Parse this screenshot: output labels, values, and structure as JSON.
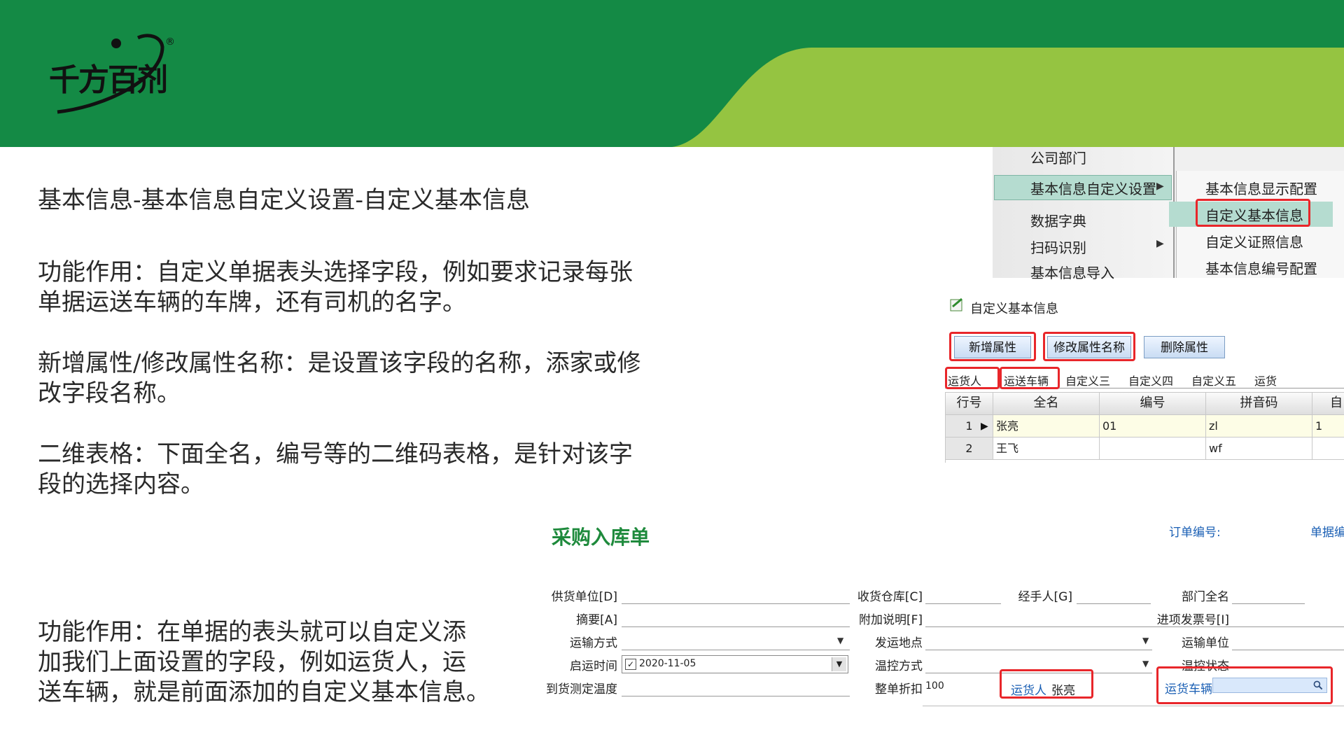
{
  "brand": {
    "logo_text": "千方百剂",
    "registered_mark": "®"
  },
  "colors": {
    "header_dark_green": "#148a45",
    "header_light_green": "#95c441",
    "title_green": "#1e8a3c",
    "highlight_red": "#e8262a",
    "menu_highlight": "#b5dcd0",
    "link_blue": "#1a5fb4"
  },
  "content": {
    "heading": "基本信息-基本信息自定义设置-自定义基本信息",
    "para1_line1": "功能作用：自定义单据表头选择字段，例如要求记录每张",
    "para1_line2": "单据运送车辆的车牌，还有司机的名字。",
    "para2_line1": "新增属性/修改属性名称：是设置该字段的名称，添家或修",
    "para2_line2": "改字段名称。",
    "para3_line1": "二维表格：下面全名，编号等的二维码表格，是针对该字",
    "para3_line2": "段的选择内容。",
    "para4_line1": "功能作用：在单据的表头就可以自定义添",
    "para4_line2": "加我们上面设置的字段，例如运货人，运",
    "para4_line3": "送车辆，就是前面添加的自定义基本信息。"
  },
  "menu": {
    "left_items": [
      "公司部门",
      "基本信息自定义设置",
      "数据字典",
      "扫码识别",
      "基本信息导入"
    ],
    "right_items": [
      "基本信息显示配置",
      "自定义基本信息",
      "自定义证照信息",
      "基本信息编号配置"
    ]
  },
  "custom_info": {
    "window_title": "自定义基本信息",
    "buttons": [
      "新增属性",
      "修改属性名称",
      "删除属性"
    ],
    "tabs": [
      "运货人",
      "运送车辆",
      "自定义三",
      "自定义四",
      "自定义五",
      "运货"
    ],
    "table": {
      "headers": [
        "行号",
        "全名",
        "编号",
        "拼音码",
        "自"
      ],
      "rows": [
        [
          "1",
          "张亮",
          "01",
          "zl",
          "1"
        ],
        [
          "2",
          "王飞",
          "",
          "wf",
          ""
        ]
      ]
    }
  },
  "form": {
    "title": "采购入库单",
    "order_no_label": "订单编号:",
    "doc_no_label": "单据编",
    "labels": {
      "supplier": "供货单位[D]",
      "summary": "摘要[A]",
      "transport_mode": "运输方式",
      "departure_time": "启运时间",
      "arrival_temp": "到货测定温度",
      "warehouse": "收货仓库[C]",
      "note": "附加说明[F]",
      "ship_from": "发运地点",
      "temp_control": "温控方式",
      "discount": "整单折扣",
      "handler": "经手人[G]",
      "department": "部门全名",
      "invoice_no": "进项发票号[I]",
      "transport_unit": "运输单位",
      "temp_status": "温控状态",
      "carrier_label": "运货人",
      "vehicle_label": "运货车辆"
    },
    "values": {
      "departure_date": "2020-11-05",
      "discount": "100",
      "carrier": "张亮"
    }
  }
}
